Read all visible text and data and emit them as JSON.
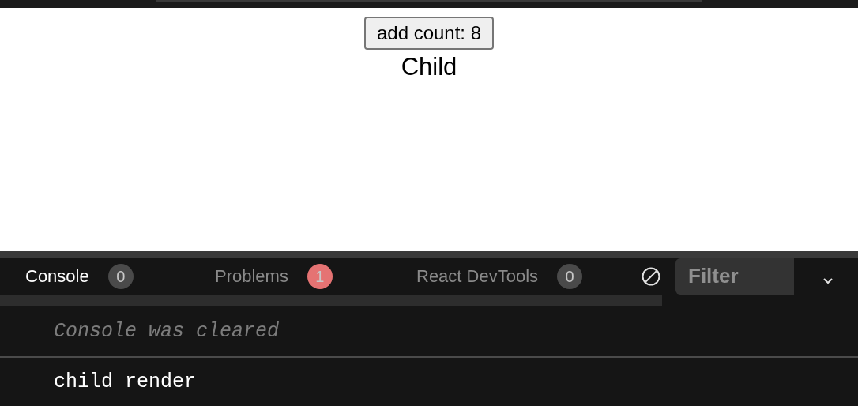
{
  "preview": {
    "button": "add count: 8",
    "text": "Child"
  },
  "tabs": [
    {
      "label": "Console",
      "count": "0",
      "selected": true,
      "color": "#4a4a4a"
    },
    {
      "label": "Problems",
      "count": "1",
      "selected": false,
      "color": "#e57373"
    },
    {
      "label": "React DevTools",
      "count": "0",
      "selected": false,
      "color": "#4a4a4a"
    }
  ],
  "filter": {
    "placeholder": "Filter"
  },
  "console": [
    {
      "kind": "info",
      "text": "Console was cleared"
    },
    {
      "kind": "log",
      "text": "child render"
    }
  ]
}
